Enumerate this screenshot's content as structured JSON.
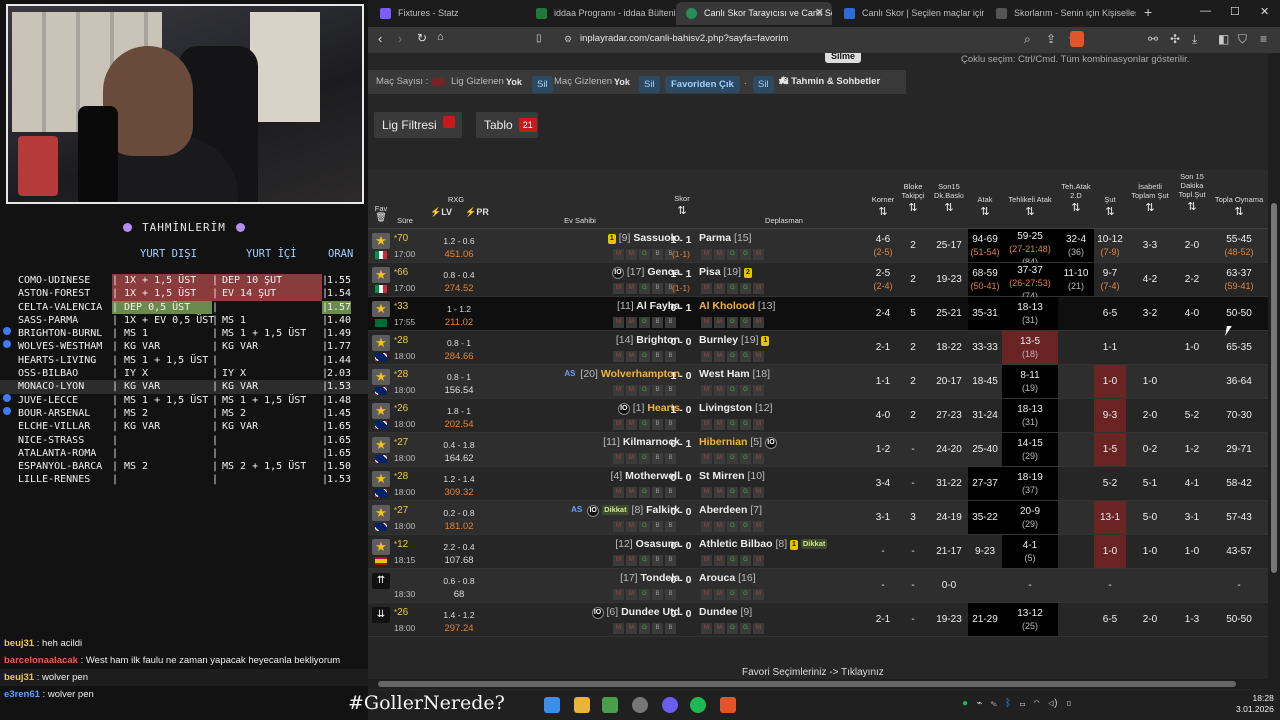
{
  "predictions": {
    "title": "TAHMİNLERİM",
    "headers": {
      "yurt_disi": "YURT DIŞI",
      "yurt_ici": "YURT İÇİ",
      "oran": "ORAN"
    },
    "rows": [
      {
        "match": "COMO-UDINESE",
        "c1": "1X + 1,5 ÜST",
        "c2": "DEP 10 ŞUT",
        "odd": "1.55",
        "hl": "red",
        "dot": false
      },
      {
        "match": "ASTON-FOREST",
        "c1": "1X + 1,5 ÜST",
        "c2": "EV 14 ŞUT",
        "odd": "1.54",
        "hl": "red",
        "dot": false
      },
      {
        "match": "CELTA-VALENCIA",
        "c1": "DEP 0,5 ÜST",
        "c2": "",
        "odd": "1.57",
        "hl": "green",
        "dot": false
      },
      {
        "match": "SASS-PARMA",
        "c1": "1X + EV 0,5 ÜST",
        "c2": "MS 1",
        "odd": "1.40",
        "hl": "",
        "dot": false
      },
      {
        "match": "BRIGHTON-BURNL",
        "c1": "MS 1",
        "c2": "MS 1 + 1,5 ÜST",
        "odd": "1.49",
        "hl": "",
        "dot": true
      },
      {
        "match": "WOLVES-WESTHAM",
        "c1": "KG VAR",
        "c2": "KG VAR",
        "odd": "1.77",
        "hl": "",
        "dot": true
      },
      {
        "match": "HEARTS-LIVING",
        "c1": "MS 1 + 1,5 ÜST",
        "c2": "",
        "odd": "1.44",
        "hl": "",
        "dot": false
      },
      {
        "match": "OSS-BILBAO",
        "c1": "IY X",
        "c2": "IY X",
        "odd": "2.03",
        "hl": "",
        "dot": false
      },
      {
        "match": "MONACO-LYON",
        "c1": "KG VAR",
        "c2": "KG VAR",
        "odd": "1.53",
        "hl": "sel",
        "dot": false
      },
      {
        "match": "JUVE-LECCE",
        "c1": "MS 1 + 1,5 ÜST",
        "c2": "MS 1 + 1,5 ÜST",
        "odd": "1.48",
        "hl": "",
        "dot": true
      },
      {
        "match": "BOUR-ARSENAL",
        "c1": "MS 2",
        "c2": "MS 2",
        "odd": "1.45",
        "hl": "",
        "dot": true
      },
      {
        "match": "ELCHE-VILLAR",
        "c1": "KG VAR",
        "c2": "KG VAR",
        "odd": "1.65",
        "hl": "",
        "dot": false
      },
      {
        "match": "NICE-STRASS",
        "c1": "",
        "c2": "",
        "odd": "1.65",
        "hl": "",
        "dot": false
      },
      {
        "match": "ATALANTA-ROMA",
        "c1": "",
        "c2": "",
        "odd": "1.65",
        "hl": "",
        "dot": false
      },
      {
        "match": "ESPANYOL-BARCA",
        "c1": "MS 2",
        "c2": "MS 2 + 1,5 ÜST",
        "odd": "1.50",
        "hl": "",
        "dot": false
      },
      {
        "match": "LILLE-RENNES",
        "c1": "",
        "c2": "",
        "odd": "1.53",
        "hl": "",
        "dot": false
      }
    ]
  },
  "chat": [
    {
      "user": "beuj31",
      "text": "heh acildi",
      "color": "#e8c84a",
      "boxed": false
    },
    {
      "user": "barcelonaalacak",
      "text": "West ham ilk faulu ne zaman yapacak heyecanla bekliyorum",
      "color": "#e0604a",
      "boxed": false
    },
    {
      "user": "beuj31",
      "text": "wolver pen",
      "color": "#e8c84a",
      "boxed": true
    },
    {
      "user": "e3ren61",
      "text": "wolver pen",
      "color": "#5aa0ff",
      "boxed": false
    }
  ],
  "hashtag": "#GollerNerede?",
  "browser": {
    "tabs": [
      {
        "label": "Fixtures - Statz",
        "icon_color": "#7a5cff",
        "active": false
      },
      {
        "label": "iddaa Programı - iddaa Bülteni | iddaa",
        "icon_color": "#1f7a3a",
        "active": false
      },
      {
        "label": "Canlı Skor Tarayıcısı ve Canlı Sonuç",
        "icon_color": "#2a8a5a",
        "active": true
      },
      {
        "label": "Canlı Skor | Seçilen maçlar için canlı",
        "icon_color": "#2c6bd6",
        "active": false
      },
      {
        "label": "Skorlarım - Senin için Kişiselleştirilmiş",
        "icon_color": "#444",
        "active": false
      }
    ],
    "url": "inplayradar.com/canli-bahisv2.php?sayfa=favorim"
  },
  "page": {
    "top_note": "Çoklu seçim: Ctrl/Cmd. Tüm kombinasyonlar gösterilir.",
    "silme_label": "Silme",
    "filterbar": {
      "mac_sayisi": "Maç Sayısı :",
      "lig_gizlenen": "Lig Gizlenen :",
      "lig_val": "Yok",
      "sil": "Sil",
      "mac_gizlenen": "Maç Gizlenen :",
      "mac_val": "Yok",
      "favoriden_cik": "Favoriden Çık",
      "ai": "AI Tahmin & Sohbetler"
    },
    "lig_filtresi": "Lig Filtresi",
    "tablo": "Tablo",
    "tablo_count": "21",
    "headers": {
      "fav": "Fav",
      "sure": "Süre",
      "rxg": "RXG",
      "lv": "LV",
      "pr": "PR",
      "ev": "Ev Sahibi",
      "skor": "Skor",
      "dep": "Deplasman",
      "korner": "Korner",
      "bloke": "Bloke Takipçi",
      "son15": "Son15 Dk.Baskı",
      "atak": "Atak",
      "teh": "Tehlikeli Atak",
      "teh2": "Teh.Atak 2.D",
      "sut": "Şut",
      "isabet": "İsabetli Toplam Şut",
      "son15sut": "Son 15 Dakika Topl.Şut",
      "topla": "Topla Oynama"
    },
    "footer": "Favori Seçimleriniz -> Tıklayınız"
  },
  "matches": [
    {
      "min": "70",
      "time": "17:00",
      "rxg": "1.2 - 0.6",
      "rxgv": "451.06",
      "home": "Sassuolo",
      "hrank": "[9]",
      "hpre": "1",
      "away": "Parma",
      "arank": "[15]",
      "score": "1 - 1",
      "ht": "(1-1)",
      "korner": "4-6",
      "kornerSub": "(2-5)",
      "bloke": "2",
      "son15": "25-17",
      "atak": "94-69",
      "atakSub": "(51-54)",
      "teh": "59-25",
      "tehSub": "(27-21:48)",
      "tehSub2": "(84)",
      "teh2": "32-4",
      "teh2Sub": "(36)",
      "sut": "10-12",
      "sutSub": "(7-9)",
      "isabet": "3-3",
      "son15sut": "2-0",
      "topla": "55-45",
      "toplaSub": "(48-52)",
      "flag": "it",
      "style": "odd"
    },
    {
      "min": "66",
      "time": "17:00",
      "rxg": "0.8 - 0.4",
      "rxgv": "274.52",
      "home": "Genoa",
      "hrank": "[17]",
      "hpre": "IO",
      "away": "Pisa",
      "arank": "[19]",
      "apost": "2",
      "score": "1 - 1",
      "ht": "(1-1)",
      "korner": "2-5",
      "kornerSub": "(2-4)",
      "bloke": "2",
      "son15": "19-23",
      "atak": "68-59",
      "atakSub": "(50-41)",
      "teh": "37-37",
      "tehSub": "(26-27:53)",
      "tehSub2": "(74)",
      "teh2": "11-10",
      "teh2Sub": "(21)",
      "sut": "9-7",
      "sutSub": "(7-4)",
      "isabet": "4-2",
      "son15sut": "2-2",
      "topla": "63-37",
      "toplaSub": "(59-41)",
      "flag": "it",
      "style": "even"
    },
    {
      "min": "33",
      "time": "17:55",
      "rxg": "1 - 1.2",
      "rxgv": "211.02",
      "home": "Al Fayha",
      "hrank": "[11]",
      "away": "Al Kholood",
      "arank": "[13]",
      "awayYel": true,
      "score": "0 - 1",
      "ht": "",
      "korner": "2-4",
      "bloke": "5",
      "son15": "25-21",
      "atak": "35-31",
      "teh": "18-13",
      "tehSub": "(31)",
      "teh2": "",
      "sut": "6-5",
      "isabet": "3-2",
      "son15sut": "4-0",
      "topla": "50-50",
      "flag": "sa",
      "style": "dark"
    },
    {
      "min": "28",
      "time": "18:00",
      "rxg": "0.8 - 1",
      "rxgv": "284.66",
      "home": "Brighton",
      "hrank": "[14]",
      "away": "Burnley",
      "arank": "[19]",
      "apost": "1",
      "score": "0 - 0",
      "ht": "",
      "korner": "2-1",
      "bloke": "2",
      "son15": "18-22",
      "atak": "33-33",
      "teh": "13-5",
      "tehSub": "(18)",
      "tehRed": true,
      "teh2": "",
      "sut": "1-1",
      "isabet": "",
      "son15sut": "1-0",
      "topla": "65-35",
      "flag": "uk",
      "style": "even"
    },
    {
      "min": "28",
      "time": "18:00",
      "rxg": "0.8 - 1",
      "rxgv": "156.54",
      "rxgWh": true,
      "home": "Wolverhampton",
      "hrank": "[20]",
      "hpre": "AS",
      "homeYel": true,
      "away": "West Ham",
      "arank": "[18]",
      "score": "1 - 0",
      "ht": "",
      "korner": "1-1",
      "bloke": "2",
      "son15": "20-17",
      "atak": "18-45",
      "teh": "8-11",
      "tehSub": "(19)",
      "tehHi": true,
      "teh2": "",
      "sut": "1-0",
      "sutRed": true,
      "isabet": "1-0",
      "son15sut": "",
      "topla": "36-64",
      "flag": "uk",
      "style": "odd"
    },
    {
      "min": "26",
      "time": "18:00",
      "rxg": "1.8 - 1",
      "rxgv": "202.54",
      "home": "Hearts",
      "hrank": "[1]",
      "hpre": "IO",
      "homeYel": true,
      "away": "Livingston",
      "arank": "[12]",
      "score": "1 - 0",
      "ht": "",
      "korner": "4-0",
      "bloke": "2",
      "son15": "27-23",
      "atak": "31-24",
      "teh": "18-13",
      "tehSub": "(31)",
      "teh2": "",
      "sut": "9-3",
      "sutRed": true,
      "isabet": "2-0",
      "son15sut": "5-2",
      "topla": "70-30",
      "flag": "uk",
      "style": "even"
    },
    {
      "min": "27",
      "time": "18:00",
      "rxg": "0.4 - 1.8",
      "rxgv": "164.62",
      "rxgWh": true,
      "home": "Kilmarnock",
      "hrank": "[11]",
      "away": "Hibernian",
      "arank": "[5]",
      "awayYel": true,
      "apost": "IO",
      "score": "0 - 1",
      "ht": "",
      "korner": "1-2",
      "bloke": "-",
      "son15": "24-20",
      "atak": "25-40",
      "teh": "14-15",
      "tehSub": "(29)",
      "teh2": "",
      "sut": "1-5",
      "sutRed": true,
      "isabet": "0-2",
      "son15sut": "1-2",
      "topla": "29-71",
      "flag": "uk",
      "style": "odd"
    },
    {
      "min": "28",
      "time": "18:00",
      "rxg": "1.2 - 1.4",
      "rxgv": "309.32",
      "home": "Motherwell",
      "hrank": "[4]",
      "away": "St Mirren",
      "arank": "[10]",
      "score": "0 - 0",
      "ht": "",
      "korner": "3-4",
      "bloke": "-",
      "son15": "31-22",
      "atak": "27-37",
      "teh": "18-19",
      "tehSub": "(37)",
      "teh2": "",
      "sut": "5-2",
      "isabet": "5-1",
      "son15sut": "4-1",
      "topla": "58-42",
      "flag": "uk",
      "style": "even"
    },
    {
      "min": "27",
      "time": "18:00",
      "rxg": "0.2 - 0.8",
      "rxgv": "181.02",
      "home": "Falkirk",
      "hrank": "[8]",
      "hpre": "AS IO Dikkat",
      "away": "Aberdeen",
      "arank": "[7]",
      "score": "0 - 0",
      "ht": "",
      "korner": "3-1",
      "bloke": "3",
      "son15": "24-19",
      "atak": "35-22",
      "teh": "20-9",
      "tehSub": "(29)",
      "teh2": "",
      "sut": "13-1",
      "sutRed": true,
      "isabet": "5-0",
      "son15sut": "3-1",
      "topla": "57-43",
      "flag": "uk",
      "style": "odd"
    },
    {
      "min": "12",
      "time": "18:15",
      "rxg": "2.2 - 0.4",
      "rxgv": "107.68",
      "rxgWh": true,
      "home": "Osasuna",
      "hrank": "[12]",
      "away": "Athletic Bilbao",
      "arank": "[8]",
      "apost": "1 Dikkat",
      "score": "0 - 0",
      "ht": "",
      "korner": "-",
      "bloke": "-",
      "son15": "21-17",
      "atak": "9-23",
      "teh": "4-1",
      "tehSub": "(5)",
      "teh2": "",
      "sut": "1-0",
      "sutRed": true,
      "isabet": "1-0",
      "son15sut": "1-0",
      "topla": "43-57",
      "flag": "es",
      "style": "even"
    },
    {
      "min": "",
      "time": "18:30",
      "rxg": "0.6 - 0.8",
      "rxgv": "68",
      "rxgWh": true,
      "home": "Tondela",
      "hrank": "[17]",
      "away": "Arouca",
      "arank": "[16]",
      "score": "0 - 0",
      "ht": "",
      "korner": "-",
      "bloke": "-",
      "son15": "0-0",
      "atak": "",
      "teh": "-",
      "teh2": "",
      "sut": "-",
      "isabet": "",
      "son15sut": "",
      "topla": "-",
      "flag": "pt",
      "style": "odd",
      "upBtn": true
    },
    {
      "min": "26",
      "time": "18:00",
      "rxg": "1.4 - 1.2",
      "rxgv": "297.24",
      "home": "Dundee Utd",
      "hrank": "[6]",
      "hpre": "IO",
      "away": "Dundee",
      "arank": "[9]",
      "score": "0 - 0",
      "ht": "",
      "korner": "2-1",
      "bloke": "-",
      "son15": "19-23",
      "atak": "21-29",
      "teh": "13-12",
      "tehSub": "(25)",
      "teh2": "",
      "sut": "6-5",
      "isabet": "2-0",
      "son15sut": "1-3",
      "topla": "50-50",
      "flag": "uk",
      "style": "even",
      "downBtn": true
    }
  ],
  "clock": {
    "time": "18:28",
    "date": "3.01.2026"
  }
}
